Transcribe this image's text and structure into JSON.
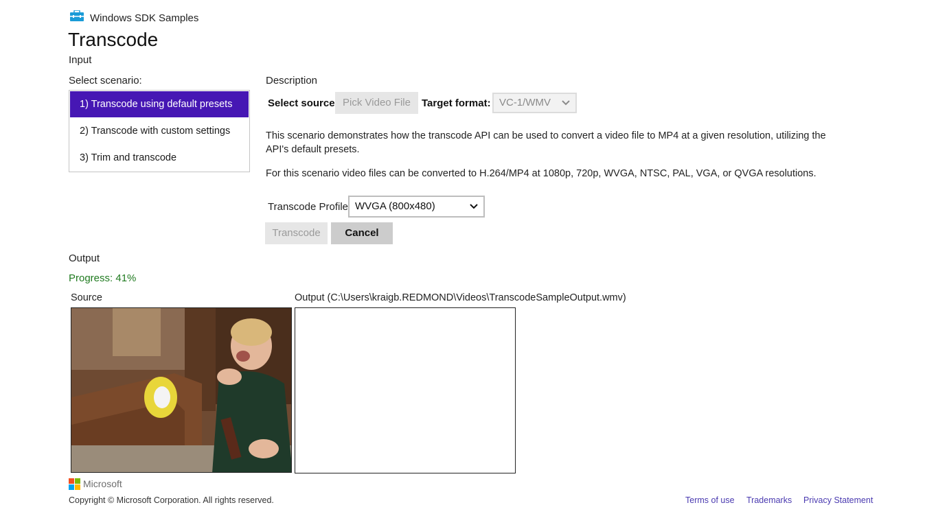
{
  "header": {
    "app_name": "Windows SDK Samples",
    "title": "Transcode",
    "icon": "sdk-toolbox-icon",
    "icon_color": "#1a9bd7"
  },
  "input": {
    "heading": "Input",
    "scenario_label": "Select scenario:",
    "scenarios": [
      "1) Transcode using default presets",
      "2) Transcode with custom settings",
      "3) Trim and transcode"
    ],
    "selected_index": 0,
    "selected_color": "#4617b4"
  },
  "description": {
    "heading": "Description",
    "select_source_label": "Select source:",
    "pick_button": "Pick Video File",
    "target_format_label": "Target format:",
    "target_format_value": "VC-1/WMV",
    "paragraph1": "This scenario demonstrates how the transcode API can be used to convert a video file to MP4 at a given resolution, utilizing the API's default presets.",
    "paragraph2": "For this scenario video files can be converted to H.264/MP4 at 1080p, 720p, WVGA, NTSC, PAL, VGA, or QVGA resolutions.",
    "profile_label": "Transcode Profile",
    "profile_value": "WVGA (800x480)",
    "transcode_button": "Transcode",
    "cancel_button": "Cancel"
  },
  "output": {
    "heading": "Output",
    "progress_text": "Progress: 41%",
    "progress_percent": 41,
    "source_label": "Source",
    "output_label": "Output (C:\\Users\\kraigb.REDMOND\\Videos\\TranscodeSampleOutput.wmv)"
  },
  "footer": {
    "brand": "Microsoft",
    "copyright": "Copyright © Microsoft Corporation. All rights reserved.",
    "links": [
      "Terms of use",
      "Trademarks",
      "Privacy Statement"
    ],
    "link_color": "#4a3ab0"
  }
}
